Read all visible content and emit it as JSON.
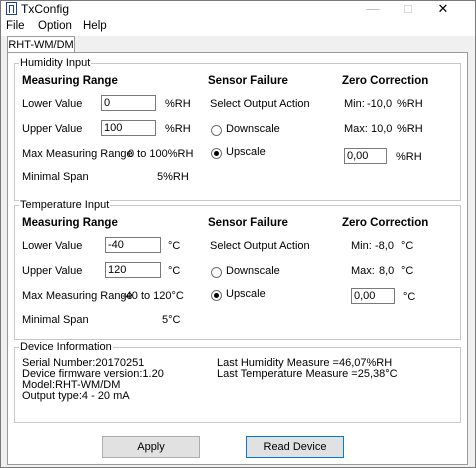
{
  "window": {
    "title": "TxConfig",
    "minimize_glyph": "—",
    "maximize_glyph": "□",
    "close_glyph": "✕"
  },
  "menu": {
    "items": [
      "File",
      "Option",
      "Help"
    ]
  },
  "tab": {
    "label": "RHT-WM/DM"
  },
  "humidity": {
    "group_title": "Humidity Input",
    "measuring_range_header": "Measuring Range",
    "sensor_failure_header": "Sensor Failure",
    "zero_correction_header": "Zero Correction",
    "lower_label": "Lower Value",
    "lower_value": "0",
    "lower_unit": "%RH",
    "upper_label": "Upper Value",
    "upper_value": "100",
    "upper_unit": "%RH",
    "max_range_label": "Max Measuring Range",
    "max_range_value": "0 to 100%RH",
    "min_span_label": "Minimal Span",
    "min_span_value": "5%RH",
    "select_output_label": "Select Output Action",
    "downscale_label": "Downscale",
    "upscale_label": "Upscale",
    "selected_output": "upscale",
    "zc_min_label": "Min:",
    "zc_min_value": "-10,0",
    "zc_min_unit": "%RH",
    "zc_max_label": "Max:",
    "zc_max_value": "10,0",
    "zc_max_unit": "%RH",
    "zc_value": "0,00",
    "zc_unit": "%RH"
  },
  "temperature": {
    "group_title": "Temperature Input",
    "measuring_range_header": "Measuring Range",
    "sensor_failure_header": "Sensor Failure",
    "zero_correction_header": "Zero Correction",
    "lower_label": "Lower Value",
    "lower_value": "-40",
    "lower_unit": "°C",
    "upper_label": "Upper Value",
    "upper_value": "120",
    "upper_unit": "°C",
    "max_range_label": "Max Measuring Range",
    "max_range_value": "-40 to 120°C",
    "min_span_label": "Minimal Span",
    "min_span_value": "5°C",
    "select_output_label": "Select Output Action",
    "downscale_label": "Downscale",
    "upscale_label": "Upscale",
    "selected_output": "upscale",
    "zc_min_label": "Min:",
    "zc_min_value": "-8,0",
    "zc_min_unit": "°C",
    "zc_max_label": "Max:",
    "zc_max_value": "8,0",
    "zc_max_unit": "°C",
    "zc_value": "0,00",
    "zc_unit": "°C"
  },
  "device": {
    "group_title": "Device Information",
    "serial": "Serial Number:20170251",
    "firmware": "Device firmware version:1.20",
    "model": "Model:RHT-WM/DM",
    "output_type": "Output type:4 - 20 mA",
    "last_humidity": "Last Humidity Measure =46,07%RH",
    "last_temperature": "Last Temperature Measure =25,38°C"
  },
  "buttons": {
    "apply": "Apply",
    "read_device": "Read Device"
  }
}
